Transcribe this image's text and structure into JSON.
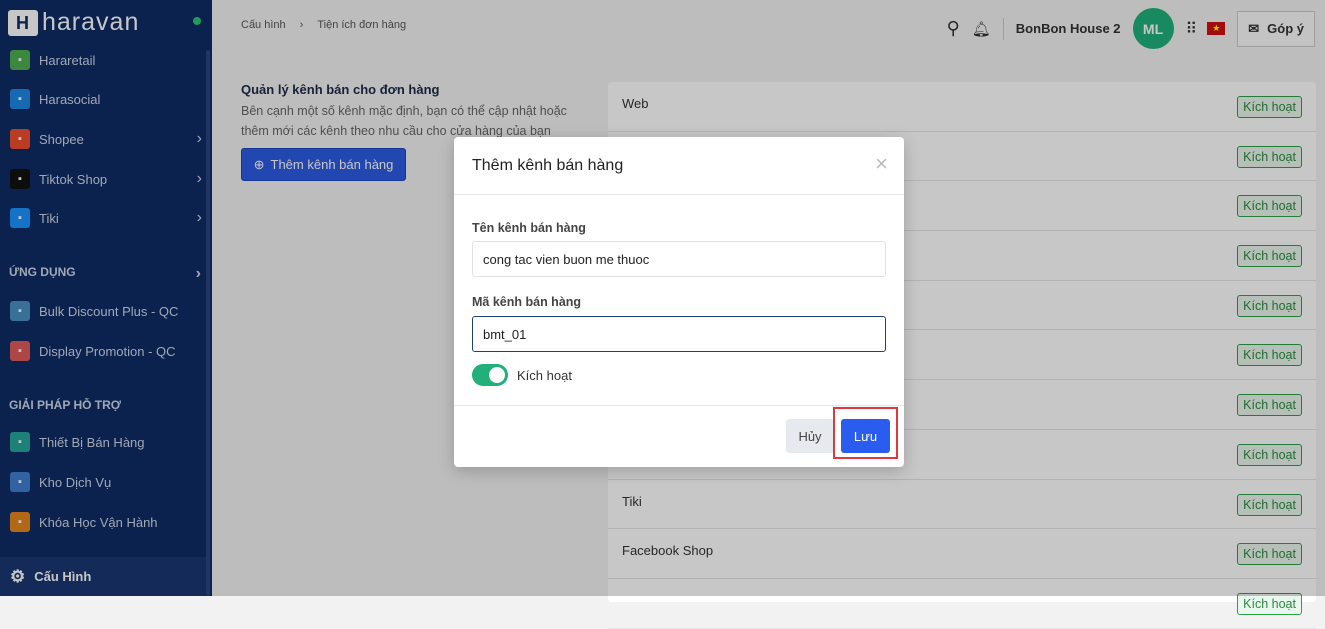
{
  "brand": "haravan",
  "sidebar": {
    "items": [
      {
        "label": "Hararetail",
        "color": "#4caf50",
        "chev": false
      },
      {
        "label": "Harasocial",
        "color": "#1e88e5",
        "chev": false
      },
      {
        "label": "Shopee",
        "color": "#ee4d2d",
        "chev": true
      },
      {
        "label": "Tiktok Shop",
        "color": "#111111",
        "chev": true
      },
      {
        "label": "Tiki",
        "color": "#1a94ff",
        "chev": true
      }
    ],
    "section_apps": "ỨNG DỤNG",
    "apps": [
      {
        "label": "Bulk Discount Plus - QC",
        "color": "#4a90c2"
      },
      {
        "label": "Display Promotion - QC",
        "color": "#e05a5a"
      }
    ],
    "section_support": "GIẢI PHÁP HỖ TRỢ",
    "support": [
      {
        "label": "Thiết Bị Bán Hàng",
        "color": "#26a69a"
      },
      {
        "label": "Kho Dịch Vụ",
        "color": "#3f7fd1"
      },
      {
        "label": "Khóa Học Vận Hành",
        "color": "#e6861f"
      }
    ],
    "bottom": "Cấu Hình"
  },
  "breadcrumb": [
    "Cấu hình",
    "Tiện ích đơn hàng"
  ],
  "topbar": {
    "store": "BonBon House 2",
    "avatar": "ML",
    "feedback": "Góp ý"
  },
  "main": {
    "title": "Quản lý kênh bán cho đơn hàng",
    "desc": "Bên cạnh một số kênh mặc định, bạn có thể cập nhật hoặc thêm mới các kênh theo nhu cầu cho cửa hàng của bạn",
    "add_button": "Thêm kênh bán hàng"
  },
  "channels": [
    {
      "name": "Web"
    },
    {
      "name": ""
    },
    {
      "name": ""
    },
    {
      "name": ""
    },
    {
      "name": ""
    },
    {
      "name": ""
    },
    {
      "name": ""
    },
    {
      "name": ""
    },
    {
      "name": "Tiki"
    },
    {
      "name": "Facebook Shop"
    },
    {
      "name": ""
    }
  ],
  "badge_label": "Kích hoạt",
  "modal": {
    "title": "Thêm kênh bán hàng",
    "name_label": "Tên kênh bán hàng",
    "name_value": "cong tac vien buon me thuoc",
    "code_label": "Mã kênh bán hàng",
    "code_value": "bmt_01",
    "toggle_label": "Kích hoạt",
    "toggle_on": true,
    "cancel": "Hủy",
    "save": "Lưu"
  }
}
